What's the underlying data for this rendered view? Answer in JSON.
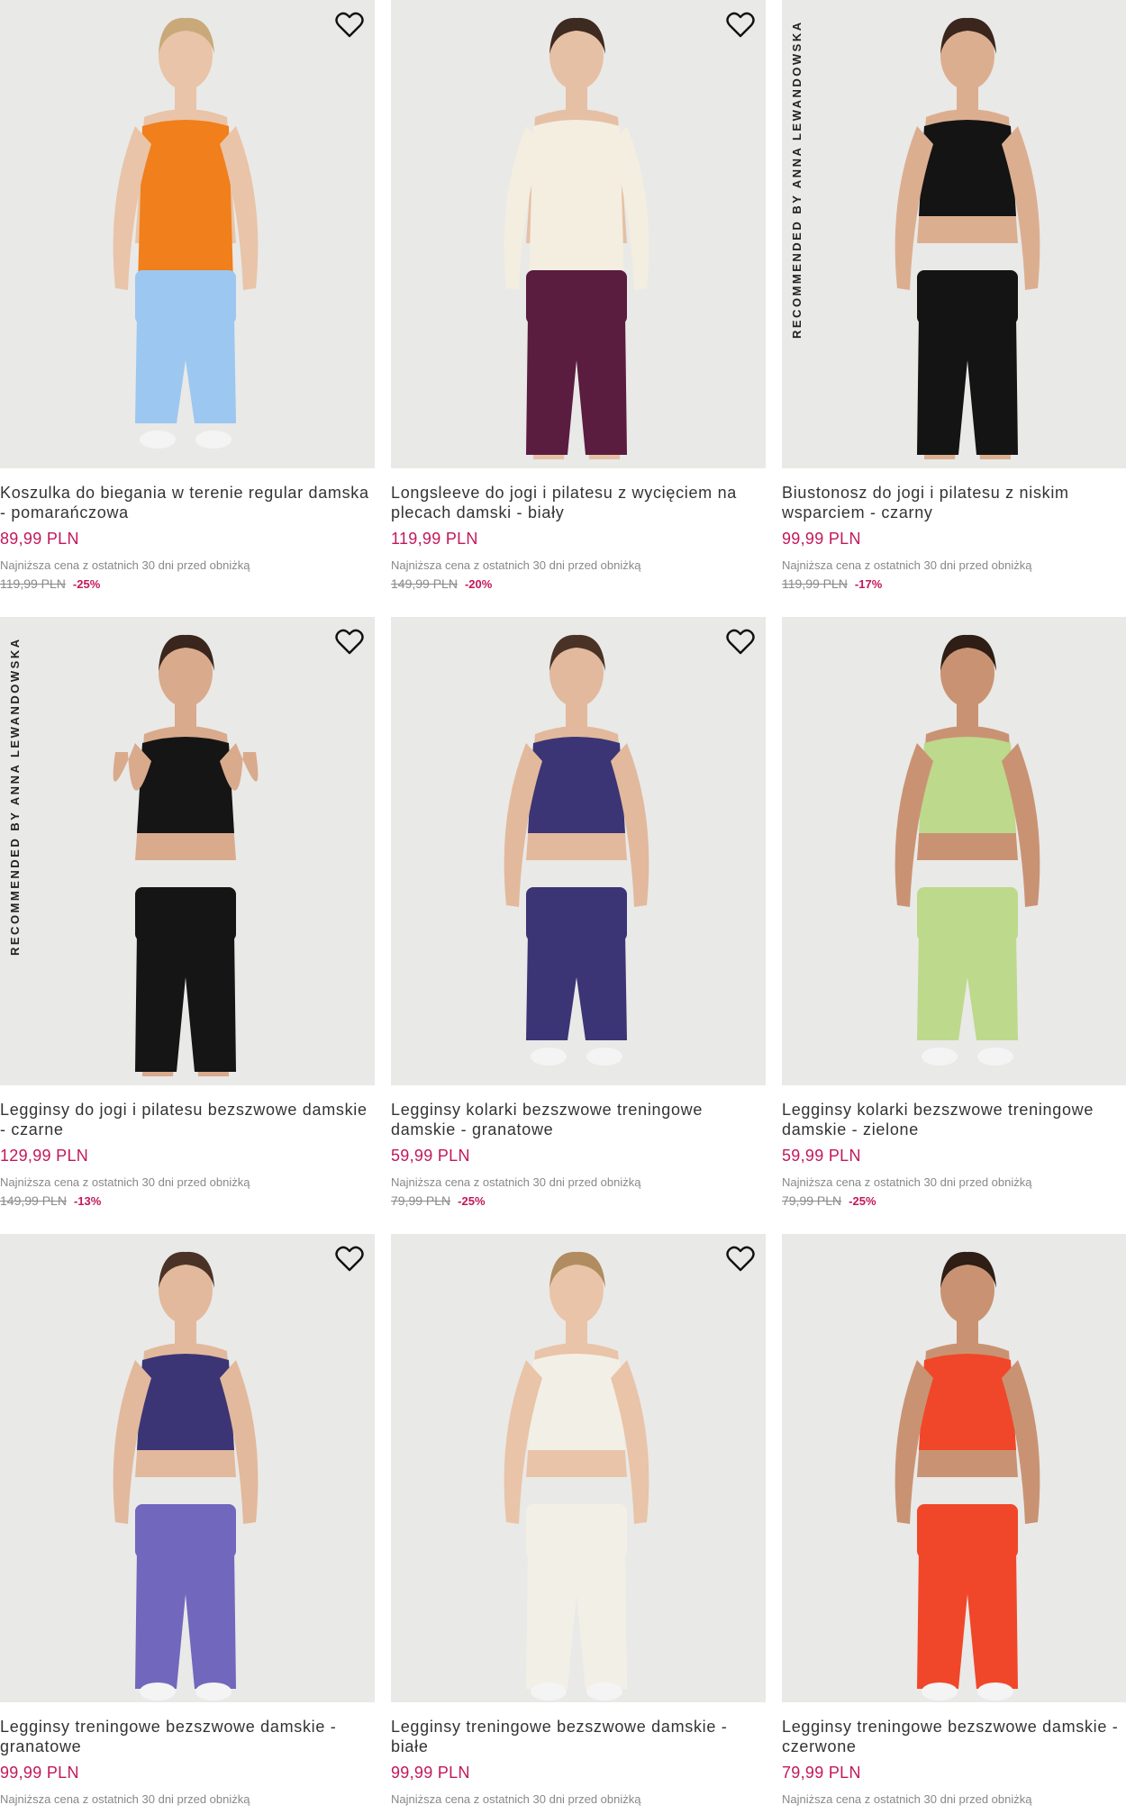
{
  "products": [
    {
      "name": "Koszulka do biegania w terenie regular damska - pomarańczowa",
      "price": "89,99 PLN",
      "lowest_label": "Najniższa cena z ostatnich 30 dni przed obniżką",
      "old_price": "119,99 PLN",
      "discount": "-25%",
      "badge": "",
      "favorite_icon": "heart-outline-icon",
      "colors": {
        "top": "#f07f1c",
        "bottom": "#9cc7f0",
        "skin": "#e9c4a8",
        "hair": "#c9a97a"
      }
    },
    {
      "name": "Longsleeve do jogi i pilatesu z wycięciem na plecach damski - biały",
      "price": "119,99 PLN",
      "lowest_label": "Najniższa cena z ostatnich 30 dni przed obniżką",
      "old_price": "149,99 PLN",
      "discount": "-20%",
      "badge": "",
      "favorite_icon": "heart-outline-icon",
      "colors": {
        "top": "#f3eedf",
        "bottom": "#5a1c3f",
        "skin": "#e6c0a4",
        "hair": "#3d2a20"
      }
    },
    {
      "name": "Biustonosz do jogi i pilatesu z niskim wsparciem - czarny",
      "price": "99,99 PLN",
      "lowest_label": "Najniższa cena z ostatnich 30 dni przed obniżką",
      "old_price": "119,99 PLN",
      "discount": "-17%",
      "badge": "RECOMMENDED BY ANNA LEWANDOWSKA",
      "favorite_icon": "",
      "colors": {
        "top": "#141414",
        "bottom": "#141414",
        "skin": "#dcae90",
        "hair": "#3a261c"
      }
    },
    {
      "name": "Legginsy do jogi i pilatesu bezszwowe damskie - czarne",
      "price": "129,99 PLN",
      "lowest_label": "Najniższa cena z ostatnich 30 dni przed obniżką",
      "old_price": "149,99 PLN",
      "discount": "-13%",
      "badge": "RECOMMENDED BY ANNA LEWANDOWSKA",
      "favorite_icon": "heart-outline-icon",
      "colors": {
        "top": "#151515",
        "bottom": "#151515",
        "skin": "#d9aa8c",
        "hair": "#3a261c"
      }
    },
    {
      "name": "Legginsy kolarki bezszwowe treningowe damskie - granatowe",
      "price": "59,99 PLN",
      "lowest_label": "Najniższa cena z ostatnich 30 dni przed obniżką",
      "old_price": "79,99 PLN",
      "discount": "-25%",
      "badge": "",
      "favorite_icon": "heart-outline-icon",
      "colors": {
        "top": "#3b3575",
        "bottom": "#3b3575",
        "skin": "#e2b99c",
        "hair": "#4a3326"
      }
    },
    {
      "name": "Legginsy kolarki bezszwowe treningowe damskie - zielone",
      "price": "59,99 PLN",
      "lowest_label": "Najniższa cena z ostatnich 30 dni przed obniżką",
      "old_price": "79,99 PLN",
      "discount": "-25%",
      "badge": "",
      "favorite_icon": "",
      "colors": {
        "top": "#bdd98b",
        "bottom": "#bdd98b",
        "skin": "#c99373",
        "hair": "#2e1e16"
      }
    },
    {
      "name": "Legginsy treningowe bezszwowe damskie - granatowe",
      "price": "99,99 PLN",
      "lowest_label": "Najniższa cena z ostatnich 30 dni przed obniżką",
      "old_price": "",
      "discount": "",
      "badge": "",
      "favorite_icon": "heart-outline-icon",
      "colors": {
        "top": "#3b3575",
        "bottom": "#7167bd",
        "skin": "#e2b99c",
        "hair": "#4a3326"
      }
    },
    {
      "name": "Legginsy treningowe bezszwowe damskie - białe",
      "price": "99,99 PLN",
      "lowest_label": "Najniższa cena z ostatnich 30 dni przed obniżką",
      "old_price": "",
      "discount": "",
      "badge": "",
      "favorite_icon": "heart-outline-icon",
      "colors": {
        "top": "#f2f0e6",
        "bottom": "#f2f0e6",
        "skin": "#e9c4a8",
        "hair": "#b08c60"
      }
    },
    {
      "name": "Legginsy treningowe bezszwowe damskie - czerwone",
      "price": "79,99 PLN",
      "lowest_label": "Najniższa cena z ostatnich 30 dni przed obniżką",
      "old_price": "",
      "discount": "",
      "badge": "",
      "favorite_icon": "",
      "colors": {
        "top": "#f0472a",
        "bottom": "#f0472a",
        "skin": "#c99373",
        "hair": "#2e1e16"
      }
    }
  ]
}
